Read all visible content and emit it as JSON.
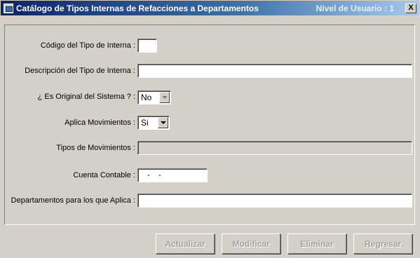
{
  "window": {
    "title": "Catálogo de Tipos Internas de Refacciones a Departamentos",
    "user_level": "Nivel de Usuario : 1",
    "close_glyph": "X"
  },
  "form": {
    "codigo": {
      "label": "Código del Tipo de Interna :",
      "value": ""
    },
    "descripcion": {
      "label": "Descripción del Tipo de Interna :",
      "value": ""
    },
    "original": {
      "label": "¿ Es Original del Sistema ? :",
      "value": "No"
    },
    "aplica": {
      "label": "Aplica Movimientos :",
      "value": "Si"
    },
    "tipos_mov": {
      "label": "Tipos de Movimientos :",
      "value": ""
    },
    "cuenta": {
      "label": "Cuenta Contable :",
      "value": "   -    -"
    },
    "departamentos": {
      "label": "Departamentos para los que Aplica :",
      "value": ""
    }
  },
  "buttons": {
    "actualizar": "Actualizar",
    "modificar": "Modificar",
    "eliminar": "Eliminar",
    "regresar": "Regresar"
  }
}
